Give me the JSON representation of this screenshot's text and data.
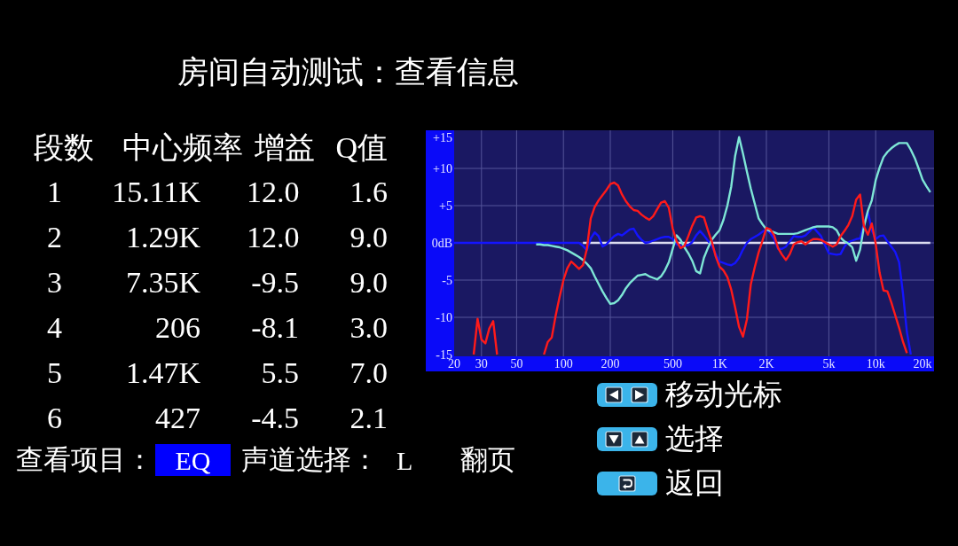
{
  "title": "房间自动测试：查看信息",
  "eq_table": {
    "columns": [
      "段数",
      "中心频率",
      "增益",
      "Q值"
    ],
    "rows": [
      [
        "1",
        "15.11K",
        "12.0",
        "1.6"
      ],
      [
        "2",
        "1.29K",
        "12.0",
        "9.0"
      ],
      [
        "3",
        "7.35K",
        "-9.5",
        "9.0"
      ],
      [
        "4",
        "206",
        "-8.1",
        "3.0"
      ],
      [
        "5",
        "1.47K",
        "5.5",
        "7.0"
      ],
      [
        "6",
        "427",
        "-4.5",
        "2.1"
      ]
    ]
  },
  "chart": {
    "chart_data": {
      "type": "line",
      "categories": [
        "20",
        null,
        null,
        null,
        null,
        null,
        null,
        "30",
        null,
        null,
        null,
        null,
        null,
        null,
        null,
        null,
        "50",
        null,
        null,
        null,
        null,
        null,
        null,
        null,
        null,
        null,
        null,
        null,
        "100",
        null,
        null,
        null,
        null,
        null,
        null,
        null,
        null,
        null,
        null,
        null,
        "200",
        null,
        null,
        null,
        null,
        null,
        null,
        null,
        null,
        null,
        null,
        null,
        null,
        null,
        null,
        null,
        "500",
        null,
        null,
        null,
        null,
        null,
        null,
        null,
        null,
        null,
        null,
        null,
        "1K",
        null,
        null,
        null,
        null,
        null,
        null,
        null,
        null,
        null,
        null,
        null,
        "2K",
        null,
        null,
        null,
        null,
        null,
        null,
        null,
        null,
        null,
        null,
        null,
        null,
        null,
        null,
        null,
        "5k",
        null,
        null,
        null,
        null,
        null,
        null,
        null,
        null,
        null,
        null,
        null,
        "10k",
        null,
        null,
        null,
        null,
        null,
        null,
        null,
        null,
        null,
        null,
        null,
        "20k",
        null,
        null
      ],
      "series": [
        {
          "color": "#dcdcf0",
          "values": [
            null,
            null,
            null,
            null,
            null,
            null,
            null,
            null,
            null,
            null,
            null,
            null,
            null,
            null,
            null,
            null,
            null,
            null,
            null,
            null,
            null,
            null,
            null,
            null,
            null,
            null,
            null,
            null,
            null,
            null,
            null,
            null,
            null,
            0,
            0,
            0,
            0,
            0,
            0,
            0,
            0,
            0,
            0,
            0,
            0,
            0,
            0,
            0,
            0,
            0,
            0,
            0,
            0,
            0,
            0,
            0,
            0,
            0,
            0,
            0,
            0,
            0,
            0,
            0,
            0,
            0,
            0,
            0,
            0,
            0,
            0,
            0,
            0,
            0,
            0,
            0,
            0,
            0,
            0,
            0,
            0,
            0,
            0,
            0,
            0,
            0,
            0,
            0,
            0,
            0,
            0,
            0,
            0,
            0,
            0,
            0,
            0,
            0,
            0,
            0,
            0,
            0,
            0,
            0,
            0,
            0,
            0,
            0,
            0,
            0,
            0,
            0,
            0,
            0,
            0,
            0,
            0,
            0,
            0,
            0,
            0,
            0,
            0
          ]
        },
        {
          "color": "#1414ff",
          "values": [
            0,
            0,
            0,
            0,
            0,
            0,
            0,
            0,
            0,
            0,
            0,
            0,
            0,
            0,
            0,
            0,
            0,
            0,
            0,
            0,
            0,
            0,
            0,
            0,
            0,
            0,
            0,
            0,
            0,
            0,
            0,
            0,
            0,
            -0.4,
            -1,
            0.6,
            1.4,
            0.9,
            -0.5,
            -0.2,
            0.4,
            0.9,
            1.2,
            1,
            1.4,
            1.8,
            1.9,
            1,
            0.4,
            0,
            0.1,
            0.3,
            0.5,
            0.7,
            0.8,
            0.8,
            0.5,
            -0.2,
            -0.4,
            -0.4,
            -0.3,
            0.1,
            1,
            1.6,
            1,
            0.3,
            -0.4,
            -1.5,
            -2.5,
            -2.7,
            -2.9,
            -3,
            -2.7,
            -2,
            -0.9,
            0,
            0.5,
            0.8,
            1.1,
            1.5,
            1.8,
            1.3,
            0.5,
            -0.8,
            -0.8,
            -0.5,
            0.2,
            0.9,
            0.8,
            0.8,
            1,
            1.5,
            2.1,
            1.5,
            0.9,
            -0.3,
            -1.4,
            -1.5,
            -1.6,
            -1.5,
            -0.5,
            0.1,
            0.3,
            0.5,
            0.6,
            2.5,
            4.2,
            1.7,
            0.5,
            0.9,
            1,
            0.2,
            -0.5,
            -1.2,
            -2.6,
            -6.8,
            -12,
            -15,
            null,
            null,
            null,
            null,
            null
          ]
        },
        {
          "color": "#7ee6d6",
          "values": [
            null,
            null,
            null,
            null,
            null,
            null,
            null,
            null,
            null,
            null,
            null,
            null,
            null,
            null,
            null,
            null,
            null,
            null,
            null,
            null,
            null,
            -0.2,
            -0.2,
            -0.3,
            -0.3,
            -0.4,
            -0.5,
            -0.6,
            -0.8,
            -1,
            -1.3,
            -1.6,
            -1.9,
            -2.3,
            -2.8,
            -3.4,
            -4.5,
            -5.5,
            -6.5,
            -7.4,
            -8.2,
            -8.1,
            -7.7,
            -7,
            -6.1,
            -5.4,
            -4.9,
            -4.4,
            -4.3,
            -4.2,
            -4.5,
            -4.7,
            -4.9,
            -4.5,
            -3.7,
            -2.6,
            -0.8,
            1,
            0.4,
            -0.6,
            -1.4,
            -2.4,
            -3.8,
            -4.1,
            -2,
            -0.7,
            0.4,
            1.1,
            1.7,
            3.1,
            5,
            7.6,
            11.7,
            14.2,
            12,
            9.6,
            7.3,
            5.3,
            3.3,
            2.5,
            1.8,
            1.6,
            1.4,
            1.2,
            1.2,
            1.2,
            1.2,
            1.2,
            1.3,
            1.5,
            1.7,
            1.9,
            2.1,
            2.2,
            2.2,
            2.2,
            2.2,
            2.1,
            1.7,
            0.7,
            0.2,
            -0.1,
            -0.6,
            -2.4,
            -0.9,
            2.2,
            4.3,
            5.7,
            8.4,
            10.1,
            11.5,
            12.2,
            12.7,
            13.1,
            13.4,
            13.4,
            13.4,
            12.5,
            11.4,
            10,
            8.5,
            7.6,
            6.8
          ]
        },
        {
          "color": "#ff1a1a",
          "values": [
            null,
            null,
            null,
            null,
            null,
            -15,
            -10.2,
            -13,
            -13.5,
            -11.5,
            -10.5,
            -15,
            null,
            null,
            null,
            null,
            null,
            null,
            null,
            null,
            null,
            null,
            null,
            -15,
            -13.3,
            -12.7,
            -9.8,
            -7.3,
            -5,
            -3.4,
            -2.5,
            -3,
            -3.5,
            -3,
            -0.8,
            3.3,
            4.8,
            5.7,
            6.4,
            7.1,
            7.9,
            8.1,
            7.7,
            6.5,
            5.6,
            4.9,
            4.4,
            4.3,
            3.8,
            3.4,
            3.1,
            3.6,
            4.5,
            5.4,
            5.6,
            4.7,
            1.9,
            0.2,
            -0.7,
            -0.4,
            0.9,
            2.3,
            3.4,
            3.6,
            3.4,
            1.7,
            0.2,
            -1.8,
            -3.2,
            -3.7,
            -4.6,
            -6.3,
            -8.7,
            -11.3,
            -12.6,
            -10.3,
            -5.6,
            -3.3,
            -1.3,
            0.3,
            2,
            1.8,
            1,
            -0.7,
            -1.6,
            -2.3,
            -1.5,
            -0.2,
            0.1,
            0.2,
            -0.2,
            0.2,
            0.5,
            0.5,
            0.4,
            0.1,
            -0.2,
            -0.5,
            -0.2,
            0.9,
            1.6,
            2.4,
            3.6,
            5.8,
            6.5,
            2.2,
            1.1,
            2.6,
            -0.1,
            -4,
            -6.4,
            -6.5,
            -8,
            -9.7,
            -11.4,
            -13.3,
            -14.8,
            null,
            null,
            null,
            null,
            null,
            null
          ]
        }
      ],
      "ylim": [
        -15,
        15
      ],
      "yticks": [
        {
          "value": 15,
          "label": "+15"
        },
        {
          "value": 10,
          "label": "+10"
        },
        {
          "value": 5,
          "label": "+5"
        },
        {
          "value": 0,
          "label": "0dB"
        },
        -5,
        -10,
        -15
      ],
      "grid": true
    }
  },
  "key_hints": [
    {
      "kind": "left_right",
      "label": "移动光标"
    },
    {
      "kind": "down_up",
      "label": "选择"
    },
    {
      "kind": "return",
      "label": "返回"
    }
  ],
  "bottom_bar": [
    {
      "kind": "field",
      "label": "查看项目：",
      "value": "EQ",
      "selected": true
    },
    {
      "kind": "field",
      "label": "声道选择：",
      "value": "L",
      "selected": false
    },
    {
      "kind": "action",
      "label": "翻页",
      "selected": false
    }
  ]
}
